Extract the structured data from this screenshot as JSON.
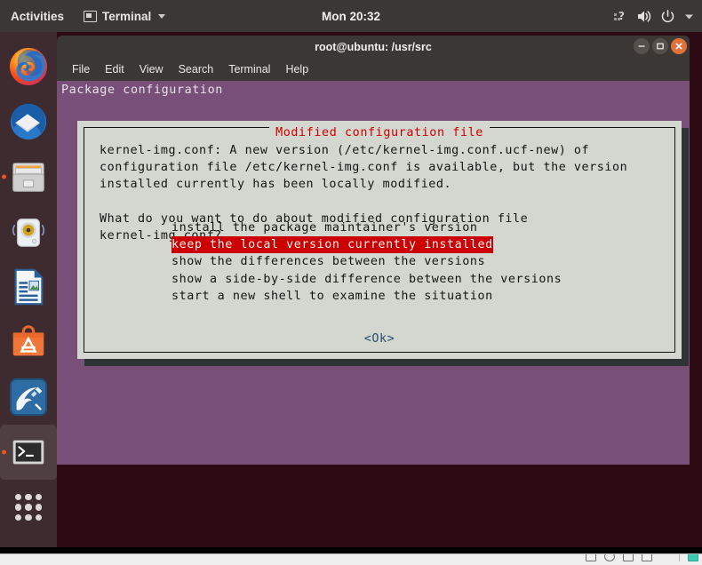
{
  "topbar": {
    "activities": "Activities",
    "app_menu": "Terminal",
    "app_icon": "terminal-icon",
    "clock": "Mon 20:32",
    "tray": [
      {
        "name": "network-question-icon"
      },
      {
        "name": "volume-icon"
      },
      {
        "name": "power-icon"
      },
      {
        "name": "chevron-down-icon"
      }
    ]
  },
  "dock": {
    "items": [
      {
        "name": "firefox",
        "label": "Firefox",
        "running": false
      },
      {
        "name": "thunderbird",
        "label": "Thunderbird Mail",
        "running": false
      },
      {
        "name": "files",
        "label": "Files",
        "running": true
      },
      {
        "name": "rhythmbox",
        "label": "Rhythmbox",
        "running": false
      },
      {
        "name": "libreoffice-impress",
        "label": "LibreOffice Impress",
        "running": false
      },
      {
        "name": "ubuntu-software",
        "label": "Ubuntu Software",
        "running": false
      },
      {
        "name": "mysql-workbench",
        "label": "MySQL Workbench",
        "running": false
      },
      {
        "name": "terminal",
        "label": "Terminal",
        "running": true
      },
      {
        "name": "show-applications",
        "label": "Show Applications",
        "running": false
      }
    ]
  },
  "window": {
    "title": "root@ubuntu: /usr/src",
    "controls": {
      "minimize": "minimize",
      "maximize": "maximize",
      "close": "close"
    },
    "menu": [
      "File",
      "Edit",
      "View",
      "Search",
      "Terminal",
      "Help"
    ]
  },
  "terminal": {
    "header_line": "Package configuration",
    "background_color": "#774f79"
  },
  "dialog": {
    "title": "Modified configuration file",
    "title_color": "#cc0000",
    "background_color": "#d3d7cf",
    "body_text": "kernel-img.conf: A new version (/etc/kernel-img.conf.ucf-new) of\nconfiguration file /etc/kernel-img.conf is available, but the version\ninstalled currently has been locally modified.\n\nWhat do you want to do about modified configuration file\nkernel-img.conf?",
    "options": [
      {
        "label": "install the package maintainer's version",
        "selected": false
      },
      {
        "label": "keep the local version currently installed",
        "selected": true
      },
      {
        "label": "show the differences between the versions",
        "selected": false
      },
      {
        "label": "show a side-by-side difference between the versions",
        "selected": false
      },
      {
        "label": "start a new shell to examine the situation",
        "selected": false
      }
    ],
    "selected_color": "#cc0000",
    "ok_button": "<Ok>"
  },
  "hostbar": {
    "title": "",
    "icons": [
      "window-icon",
      "clock-icon",
      "window-icon",
      "window-icon",
      "sound-icon",
      "teal-icon"
    ]
  }
}
